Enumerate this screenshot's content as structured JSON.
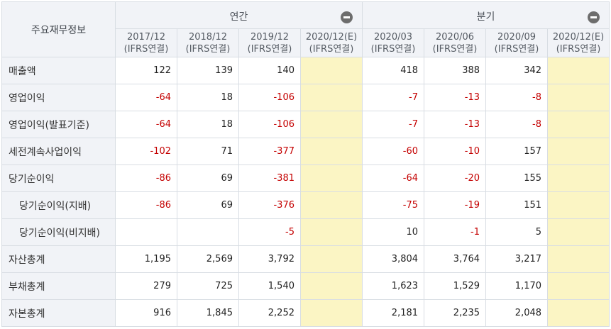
{
  "corner": "주요재무정보",
  "groups": [
    {
      "label": "연간"
    },
    {
      "label": "분기"
    }
  ],
  "columns": [
    {
      "period": "2017/12",
      "basis": "(IFRS연결)"
    },
    {
      "period": "2018/12",
      "basis": "(IFRS연결)"
    },
    {
      "period": "2019/12",
      "basis": "(IFRS연결)"
    },
    {
      "period": "2020/12(E)",
      "basis": "(IFRS연결)"
    },
    {
      "period": "2020/03",
      "basis": "(IFRS연결)"
    },
    {
      "period": "2020/06",
      "basis": "(IFRS연결)"
    },
    {
      "period": "2020/09",
      "basis": "(IFRS연결)"
    },
    {
      "period": "2020/12(E)",
      "basis": "(IFRS연결)"
    }
  ],
  "rows": [
    {
      "label": "매출액",
      "indent": false,
      "values": [
        "122",
        "139",
        "140",
        "",
        "418",
        "388",
        "342",
        ""
      ]
    },
    {
      "label": "영업이익",
      "indent": false,
      "values": [
        "-64",
        "18",
        "-106",
        "",
        "-7",
        "-13",
        "-8",
        ""
      ]
    },
    {
      "label": "영업이익(발표기준)",
      "indent": false,
      "values": [
        "-64",
        "18",
        "-106",
        "",
        "-7",
        "-13",
        "-8",
        ""
      ]
    },
    {
      "label": "세전계속사업이익",
      "indent": false,
      "values": [
        "-102",
        "71",
        "-377",
        "",
        "-60",
        "-10",
        "157",
        ""
      ]
    },
    {
      "label": "당기순이익",
      "indent": false,
      "values": [
        "-86",
        "69",
        "-381",
        "",
        "-64",
        "-20",
        "155",
        ""
      ]
    },
    {
      "label": "당기순이익(지배)",
      "indent": true,
      "values": [
        "-86",
        "69",
        "-376",
        "",
        "-75",
        "-19",
        "151",
        ""
      ]
    },
    {
      "label": "당기순이익(비지배)",
      "indent": true,
      "values": [
        "",
        "",
        "-5",
        "",
        "10",
        "-1",
        "5",
        ""
      ]
    },
    {
      "label": "자산총계",
      "indent": false,
      "values": [
        "1,195",
        "2,569",
        "3,792",
        "",
        "3,804",
        "3,764",
        "3,217",
        ""
      ]
    },
    {
      "label": "부채총계",
      "indent": false,
      "values": [
        "279",
        "725",
        "1,540",
        "",
        "1,623",
        "1,529",
        "1,170",
        ""
      ]
    },
    {
      "label": "자본총계",
      "indent": false,
      "values": [
        "916",
        "1,845",
        "2,252",
        "",
        "2,181",
        "2,235",
        "2,048",
        ""
      ]
    }
  ],
  "colors": {
    "header_bg": "#f1f3f7",
    "estimate_bg": "#fbf5c4",
    "negative": "#c40000",
    "border": "#d8dde3"
  }
}
